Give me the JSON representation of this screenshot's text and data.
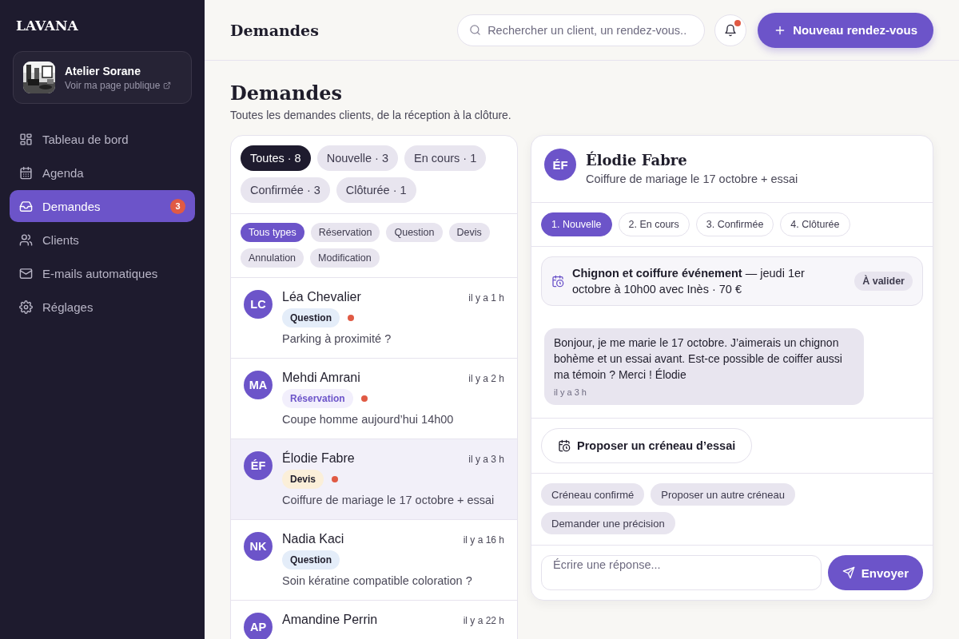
{
  "sidebar": {
    "logo": "LAVANA",
    "profile": {
      "name": "Atelier Sorane",
      "link": "Voir ma page publique"
    },
    "nav": [
      {
        "label": "Tableau de bord",
        "selected": false
      },
      {
        "label": "Agenda",
        "selected": false
      },
      {
        "label": "Demandes",
        "selected": true,
        "badge": "3"
      },
      {
        "label": "Clients",
        "selected": false
      },
      {
        "label": "E-mails automatiques",
        "selected": false
      },
      {
        "label": "Réglages",
        "selected": false
      }
    ]
  },
  "topbar": {
    "title": "Demandes",
    "search": {
      "placeholder": "Rechercher un client, un rendez-vous.."
    },
    "notifications": {
      "unread": true
    },
    "new_button": "Nouveau rendez-vous"
  },
  "page": {
    "title": "Demandes",
    "subtitle": "Toutes les demandes clients, de la réception à la clôture."
  },
  "status_filters": [
    {
      "label": "Toutes · 8",
      "selected": true
    },
    {
      "label": "Nouvelle · 3",
      "selected": false
    },
    {
      "label": "En cours · 1",
      "selected": false
    },
    {
      "label": "Confirmée · 3",
      "selected": false
    },
    {
      "label": "Clôturée · 1",
      "selected": false
    }
  ],
  "type_filters": [
    {
      "label": "Tous types",
      "selected": true
    },
    {
      "label": "Réservation",
      "selected": false
    },
    {
      "label": "Question",
      "selected": false
    },
    {
      "label": "Devis",
      "selected": false
    },
    {
      "label": "Annulation",
      "selected": false
    },
    {
      "label": "Modification",
      "selected": false
    }
  ],
  "requests": [
    {
      "initials": "LC",
      "name": "Léa Chevalier",
      "time": "il y a 1 h",
      "tag": {
        "label": "Question",
        "kind": "question"
      },
      "unread": true,
      "summary": "Parking à proximité ?",
      "selected": false
    },
    {
      "initials": "MA",
      "name": "Mehdi Amrani",
      "time": "il y a 2 h",
      "tag": {
        "label": "Réservation",
        "kind": "reservation"
      },
      "unread": true,
      "summary": "Coupe homme aujourd’hui 14h00",
      "selected": false
    },
    {
      "initials": "ÉF",
      "name": "Élodie Fabre",
      "time": "il y a 3 h",
      "tag": {
        "label": "Devis",
        "kind": "devis"
      },
      "unread": true,
      "summary": "Coiffure de mariage le 17 octobre + essai",
      "selected": true
    },
    {
      "initials": "NK",
      "name": "Nadia Kaci",
      "time": "il y a 16 h",
      "tag": {
        "label": "Question",
        "kind": "question"
      },
      "unread": false,
      "summary": "Soin kératine compatible coloration ?",
      "selected": false
    },
    {
      "initials": "AP",
      "name": "Amandine Perrin",
      "time": "il y a 22 h",
      "selected": false
    }
  ],
  "detail": {
    "initials": "ÉF",
    "name": "Élodie Fabre",
    "subject": "Coiffure de mariage le 17 octobre + essai",
    "steps": [
      {
        "label": "1. Nouvelle",
        "selected": true
      },
      {
        "label": "2. En cours",
        "selected": false
      },
      {
        "label": "3. Confirmée",
        "selected": false
      },
      {
        "label": "4. Clôturée",
        "selected": false
      }
    ],
    "booking": {
      "text": "**Chignon et coiffure événement** — jeudi 1er octobre à 10h00 avec Inès · 70 €",
      "status": "À valider"
    },
    "message": {
      "text": "Bonjour, je me marie le 17 octobre. J’aimerais un chignon bohème et un essai avant. Est-ce possible de coiffer aussi ma témoin ? Merci ! Élodie",
      "time": "il y a 3 h"
    },
    "action": "Proposer un créneau d’essai",
    "quick_replies": [
      "Créneau confirmé",
      "Proposer un autre créneau",
      "Demander une précision"
    ],
    "reply": {
      "placeholder": "Écrire une réponse..."
    },
    "send": "Envoyer"
  }
}
